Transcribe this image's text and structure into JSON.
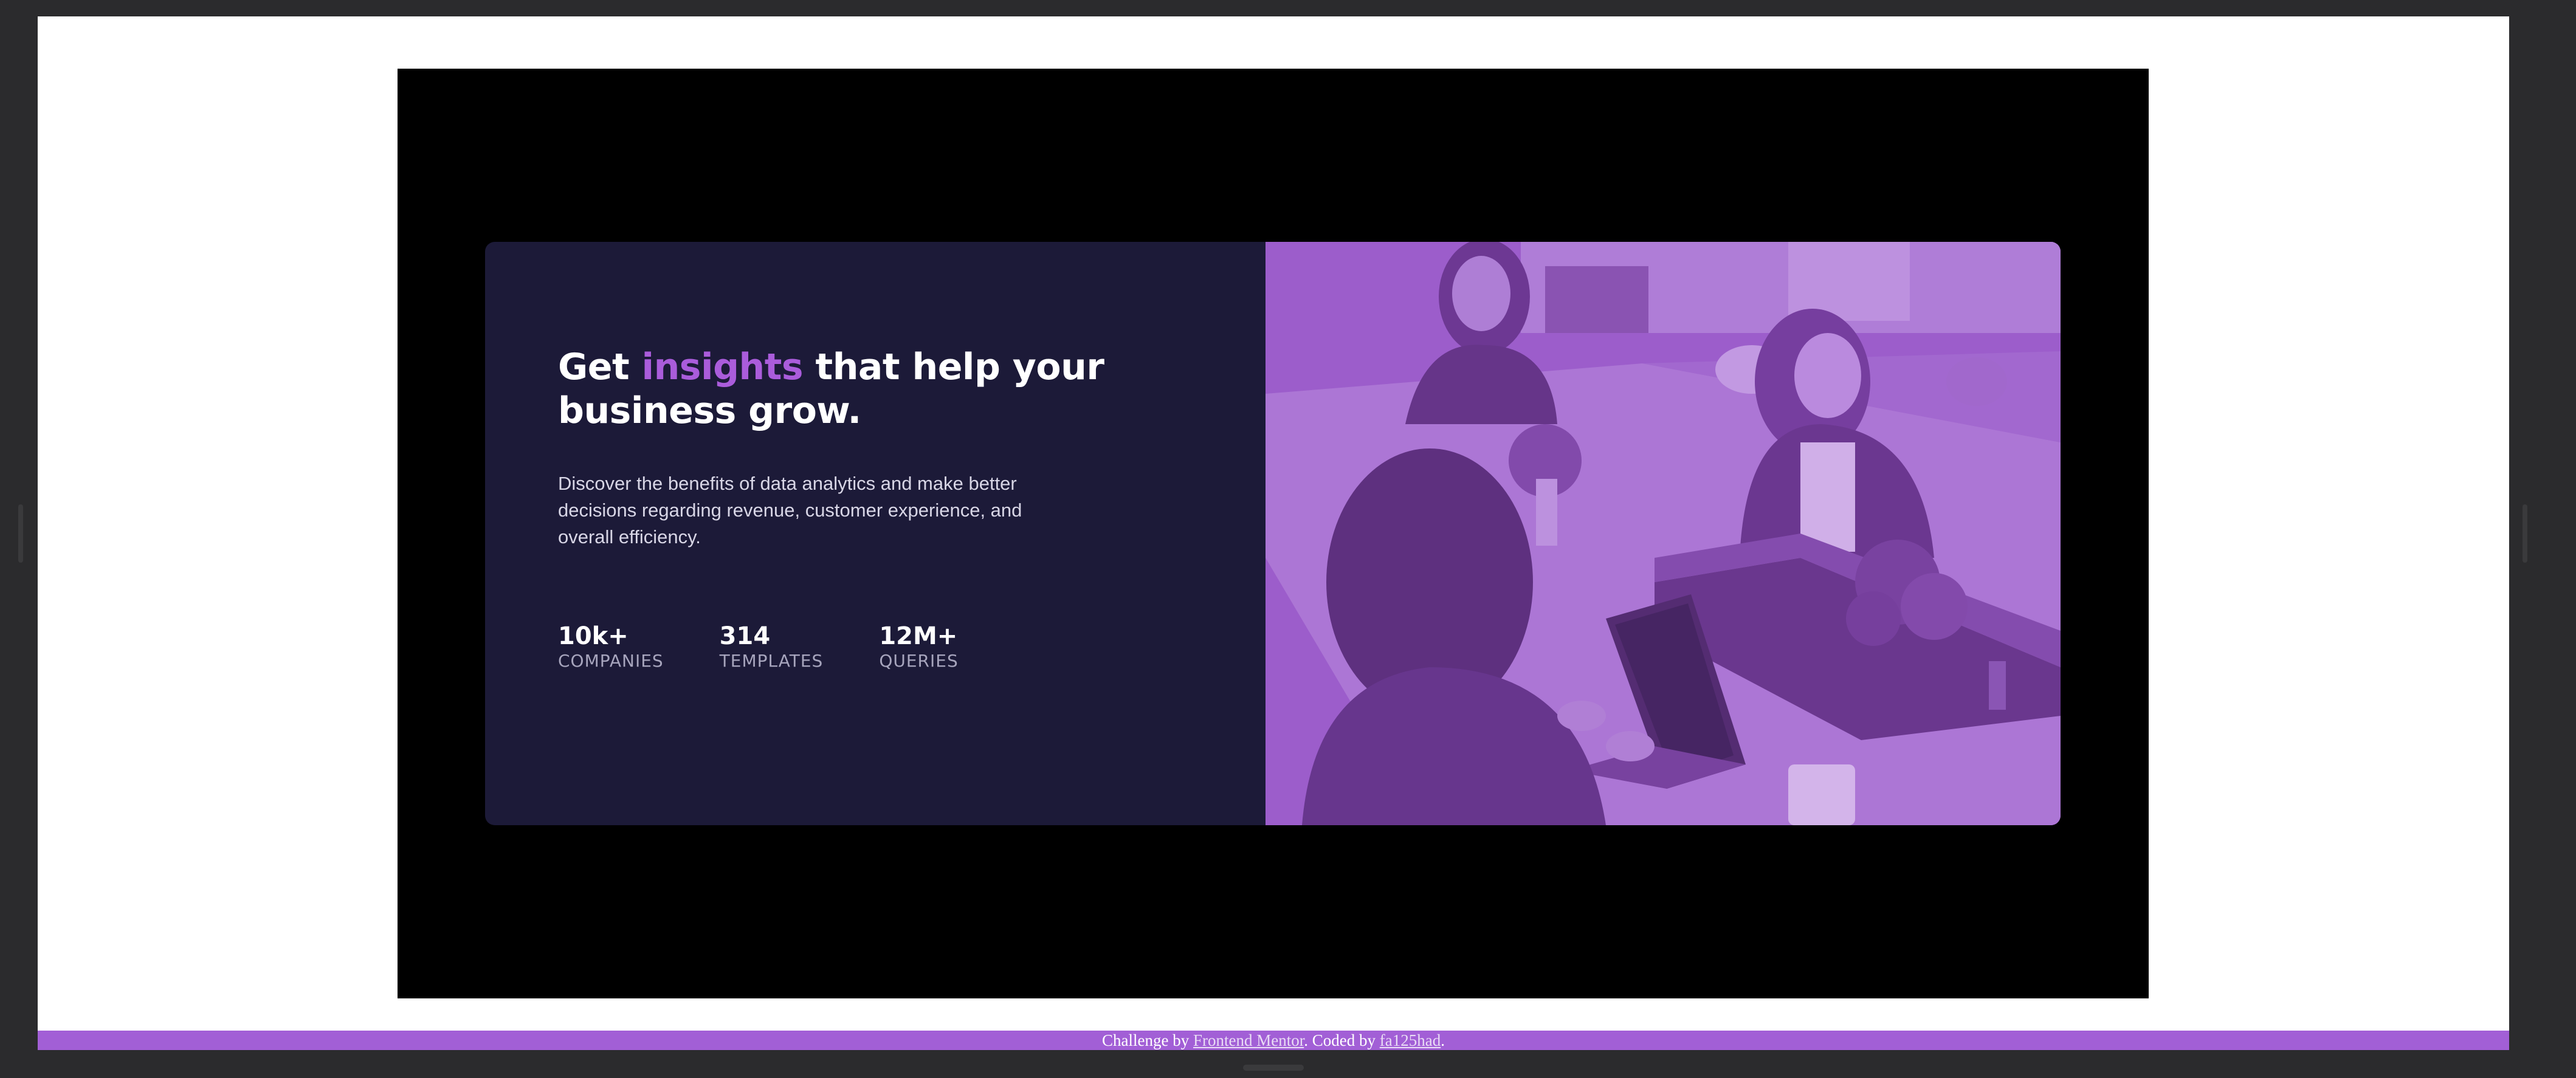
{
  "card": {
    "heading_prefix": "Get ",
    "heading_accent": "insights",
    "heading_suffix": " that help your business grow.",
    "description": "Discover the benefits of data analytics and make better decisions regarding revenue, customer experience, and overall efficiency.",
    "stats": [
      {
        "value": "10k+",
        "label": "COMPANIES"
      },
      {
        "value": "314",
        "label": "TEMPLATES"
      },
      {
        "value": "12M+",
        "label": "QUERIES"
      }
    ],
    "image": {
      "alt": "Colleagues working together at a shared office table"
    }
  },
  "footer": {
    "prefix": "Challenge by ",
    "link1": "Frontend Mentor",
    "middle": ". Coded by ",
    "link2": "fa125had",
    "suffix": "."
  },
  "colors": {
    "card_bg": "#1c1a38",
    "accent": "#aa5cdb",
    "overlay": "#9d5dcc",
    "footer_bg": "#a25fd6"
  }
}
